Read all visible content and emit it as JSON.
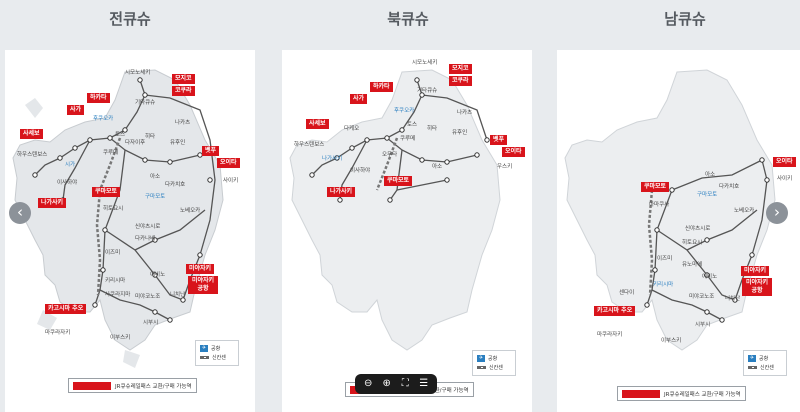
{
  "headings": {
    "left": "전큐슈",
    "middle": "북큐슈",
    "right": "남큐슈"
  },
  "colors": {
    "background": "#e8ebee",
    "card": "#ffffff",
    "accent_red": "#d8141b",
    "airport_blue": "#2a7fc0",
    "rail_line": "#555555"
  },
  "maps": {
    "all": {
      "red_labels": [
        "모지코",
        "코쿠라",
        "하카타",
        "사가",
        "사세보",
        "벳푸",
        "오이타",
        "쿠마모토",
        "나가사키",
        "미야자키",
        "미야자키 공항",
        "카고시마 추오"
      ],
      "cities": [
        "시모노세키",
        "기타큐슈",
        "다자이후",
        "토스",
        "후쿠오카",
        "쿠루메",
        "하우스텐보스",
        "유후인",
        "나카츠",
        "시가",
        "이사하야",
        "히타",
        "아소",
        "사이키",
        "노베오카",
        "구마모토",
        "다카치호",
        "다카나베",
        "히토요시",
        "신야츠시로",
        "이즈미",
        "에비노",
        "미야코노조",
        "니치난",
        "시부시",
        "이부스키",
        "마쿠라자키",
        "키리시마",
        "사쿠라지마"
      ],
      "legend_airport": "공항",
      "legend_shinkansen": "신칸센",
      "pass_note": "JR큐슈레일패스 교환/구매 가능역"
    },
    "north": {
      "red_labels": [
        "모지코",
        "코쿠라",
        "하카타",
        "사가",
        "사세보",
        "벳푸",
        "오이타",
        "쿠마모토",
        "나가사키"
      ],
      "cities": [
        "시모노세키",
        "기타큐슈",
        "후쿠오카",
        "쿠루메",
        "토스",
        "하우스텐보스",
        "유후인",
        "나카츠",
        "히타",
        "아소",
        "이사하야",
        "오무타",
        "나가사키",
        "다케오",
        "우스키"
      ],
      "legend_airport": "공항",
      "legend_shinkansen": "신칸센",
      "pass_note": "JR큐슈레일패스 교환/구매 가능역"
    },
    "south": {
      "red_labels": [
        "오이타",
        "쿠마모토",
        "미야자키",
        "미야자키 공항",
        "카고시마 추오"
      ],
      "cities": [
        "아소",
        "사이키",
        "노베오카",
        "구마모토",
        "다카치호",
        "히토요시",
        "신야츠시로",
        "이즈미",
        "에비노",
        "미야코노조",
        "니치난",
        "시부시",
        "이부스키",
        "마쿠라자키",
        "키리시마",
        "센다이",
        "아마쿠사",
        "유노마에"
      ],
      "legend_airport": "공항",
      "legend_shinkansen": "신칸센",
      "pass_note": "JR큐슈레일패스 교환/구매 가능역"
    }
  },
  "viewer_toolbar": {
    "zoom_out": "⊖",
    "zoom_in": "⊕",
    "fullscreen": "⛶",
    "info": "☰"
  },
  "nav": {
    "prev": "‹",
    "next": "›"
  },
  "icons": {
    "airport": "plane-icon",
    "shinkansen": "rail-dash-icon"
  }
}
